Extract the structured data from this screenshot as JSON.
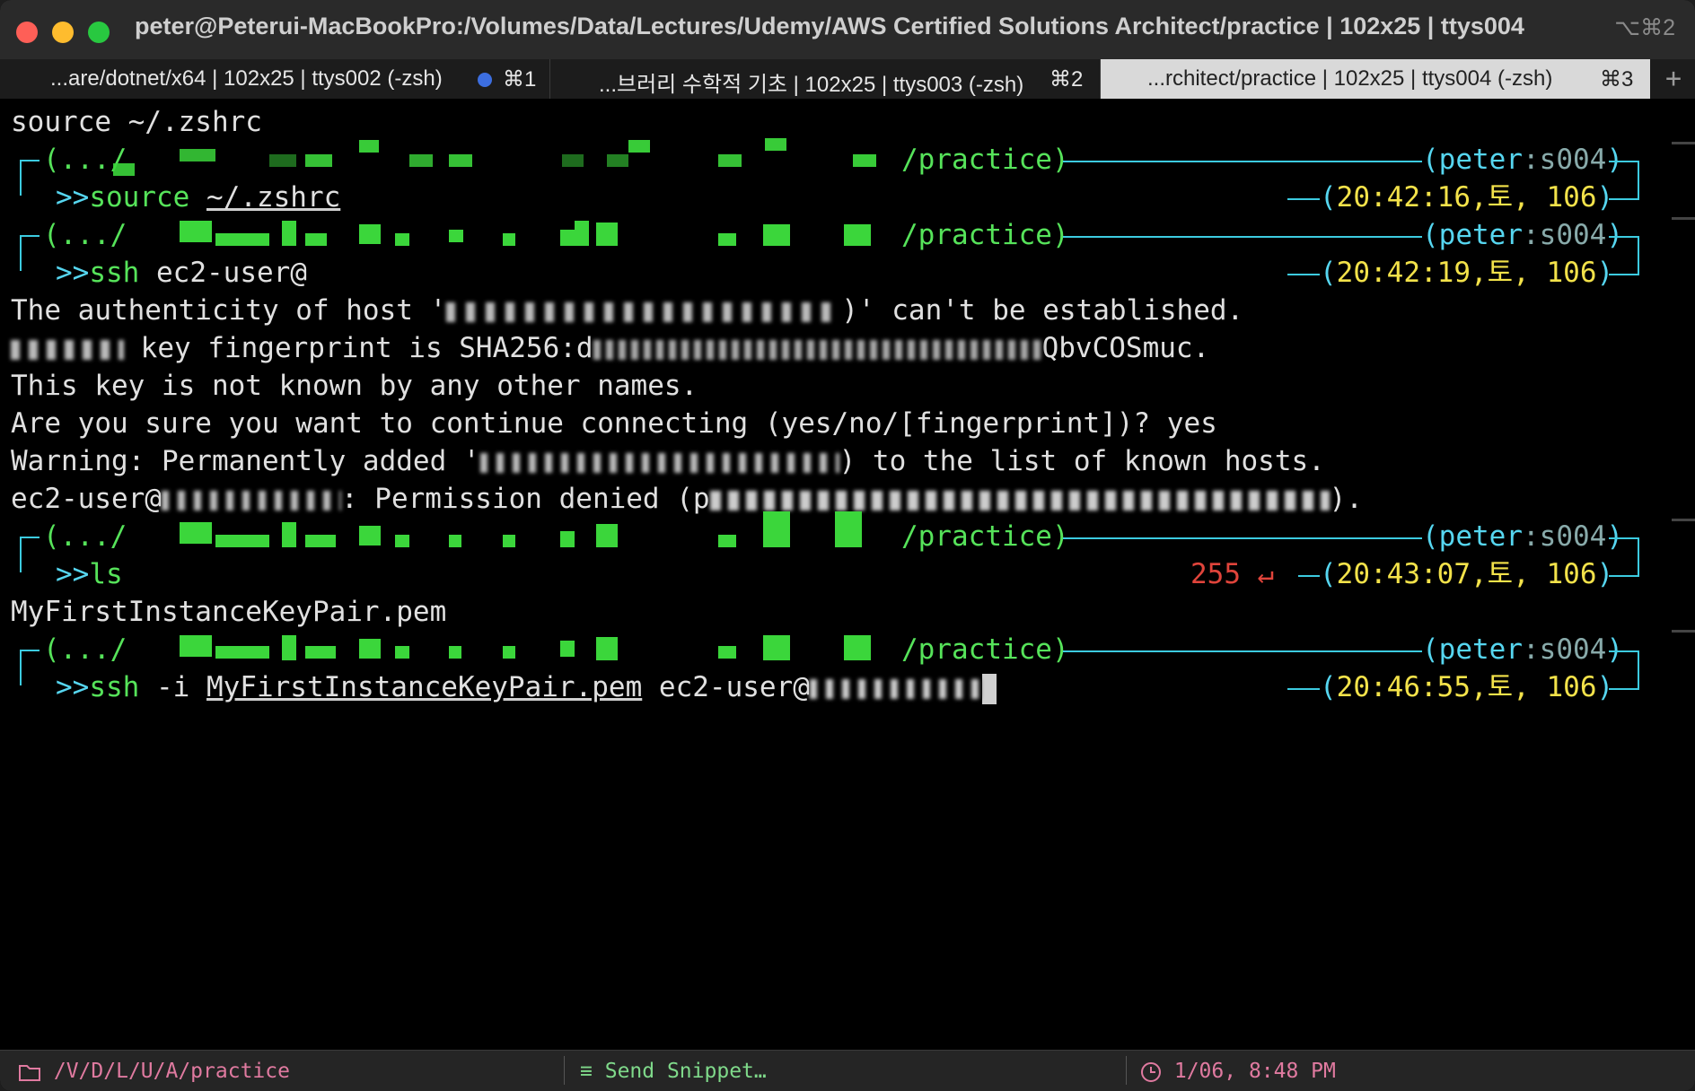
{
  "window": {
    "title": "peter@Peterui-MacBookPro:/Volumes/Data/Lectures/Udemy/AWS Certified Solutions Architect/practice | 102x25 | ttys004",
    "shortcut": "⌥⌘2"
  },
  "tabs": [
    {
      "label": "...are/dotnet/x64 | 102x25 | ttys002 (-zsh)",
      "key": "⌘1"
    },
    {
      "label": "...브러리 수학적 기초 | 102x25 | ttys003 (-zsh)",
      "key": "⌘2"
    },
    {
      "label": "...rchitect/practice | 102x25 | ttys004 (-zsh)",
      "key": "⌘3"
    }
  ],
  "add_tab": "+",
  "terminal": {
    "first_line": "source ~/.zshrc",
    "prompts": [
      {
        "dir_prefix": "(.../",
        "dir_suffix": "/practice)",
        "user": "peter",
        "tty": ":s004",
        "command": "source",
        "arg": "~/.zshrc",
        "time": "20:42:16,토, 106"
      },
      {
        "dir_prefix": "(.../",
        "dir_suffix": "/practice)",
        "user": "peter",
        "tty": ":s004",
        "command": "ssh",
        "arg": "ec2-user@",
        "time": "20:42:19,토, 106"
      },
      {
        "dir_prefix": "(.../",
        "dir_suffix": "/practice)",
        "user": "peter",
        "tty": ":s004",
        "command": "ls",
        "arg": "",
        "time": "20:43:07,토, 106",
        "exit_code": "255 ↵"
      },
      {
        "dir_prefix": "(.../",
        "dir_suffix": "/practice)",
        "user": "peter",
        "tty": ":s004",
        "command": "ssh",
        "arg": " -i ",
        "arg2": "MyFirstInstanceKeyPair.pem",
        "arg3": " ec2-user@",
        "time": "20:46:55,토, 106"
      }
    ],
    "output_ssh": [
      {
        "pre": "The authenticity of host '",
        "post": ")' can't be established."
      },
      {
        "pre": "",
        "post": " key fingerprint is SHA256:d",
        "tail": "QbvCOSmuc."
      },
      {
        "pre": "This key is not known by any other names.",
        "post": ""
      },
      {
        "pre": "Are you sure you want to continue connecting (yes/no/[fingerprint])? yes",
        "post": ""
      },
      {
        "pre": "Warning: Permanently added '",
        "post": ") to the list of known hosts."
      },
      {
        "pre": "ec2-user@",
        "post": ": Permission denied (p",
        "tail": ")."
      }
    ],
    "output_ls": "MyFirstInstanceKeyPair.pem",
    "prompt_arrow": ">>"
  },
  "statusbar": {
    "path": "/V/D/L/U/A/practice",
    "snippet": "Send Snippet…",
    "clock": "1/06, 8:48 PM"
  },
  "colors": {
    "green": "#56e35a",
    "cyan": "#56d6f0",
    "yellow": "#f3e24a",
    "red": "#e0443b",
    "tab_dot": "#3c6ee0"
  }
}
